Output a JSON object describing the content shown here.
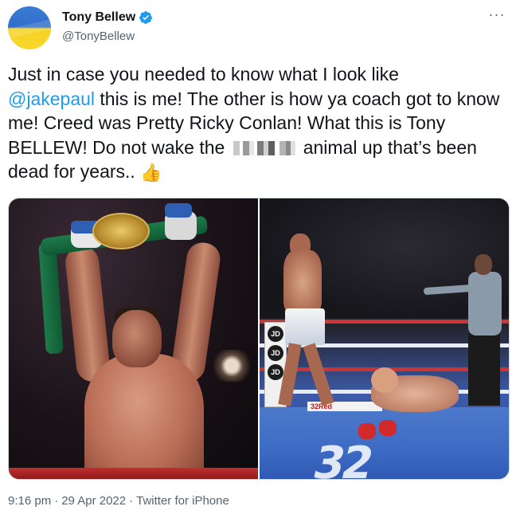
{
  "author": {
    "display_name": "Tony Bellew",
    "handle": "@TonyBellew",
    "verified": true,
    "avatar_icon": "ukraine-flag-avatar"
  },
  "tweet": {
    "line1": "Just in case you needed to know what I look like",
    "mention": "@jakepaul",
    "after_mention": " this is me! The other is how ya coach got to know me! Creed was Pretty Ricky Conlan! What this is Tony BELLEW! Do not wake the ",
    "after_censor": "animal up that’s been dead for years.. ",
    "emoji": "👍"
  },
  "media": {
    "right_post_labels": [
      "JD",
      "JD",
      "JD"
    ],
    "apron_text": "32Red",
    "canvas_logo": "32"
  },
  "meta": {
    "time": "9:16 pm",
    "date": "29 Apr 2022",
    "source": "Twitter for iPhone",
    "separator": "·"
  },
  "colors": {
    "link": "#1d9bf0",
    "verified": "#1d9bf0",
    "secondary_text": "#536471"
  }
}
